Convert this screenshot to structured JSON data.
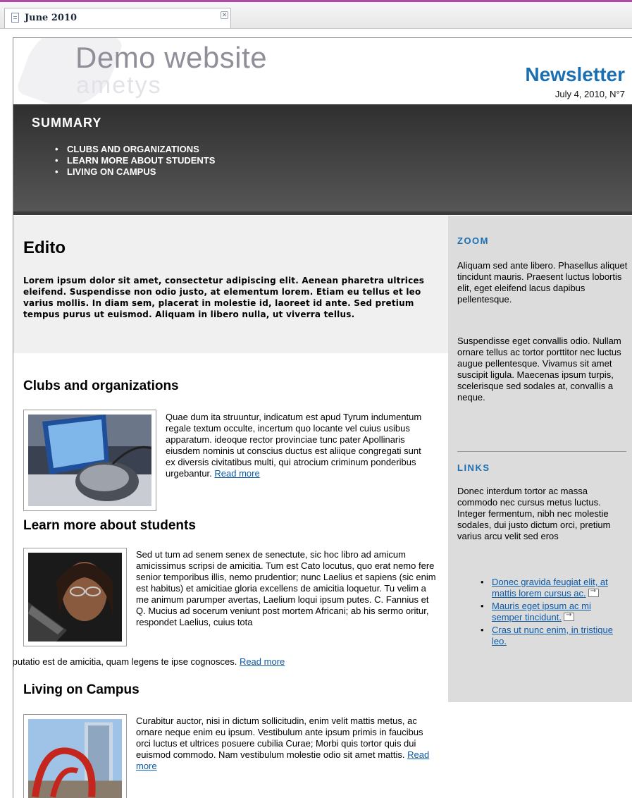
{
  "tab": {
    "title": "June 2010"
  },
  "header": {
    "logo_main": "Demo website",
    "logo_sub": "ametys",
    "title": "Newsletter",
    "date": "July 4, 2010, N°7"
  },
  "summary": {
    "title": "SUMMARY",
    "items": [
      "CLUBS AND ORGANIZATIONS",
      "LEARN MORE ABOUT STUDENTS",
      "LIVING ON CAMPUS"
    ]
  },
  "edito": {
    "title": "Edito",
    "text": "Lorem ipsum dolor sit amet, consectetur adipiscing elit. Aenean pharetra ultrices eleifend. Suspendisse non odio justo, at elementum lorem. Etiam eu tellus et leo varius mollis. In diam sem, placerat in molestie id, laoreet id ante. Sed pretium tempus purus ut euismod. Aliquam in libero nulla, ut viverra tellus."
  },
  "articles": [
    {
      "title": "Clubs and organizations",
      "text": "Quae dum ita struuntur, indicatum est apud Tyrum indumentum regale textum occulte, incertum quo locante vel cuius usibus apparatum. ideoque rector provinciae tunc pater Apollinaris eiusdem nominis ut conscius ductus est aliique congregati sunt ex diversis civitatibus multi, qui atrocium criminum ponderibus urgebantur.",
      "read_more": "Read more"
    },
    {
      "title": "Learn more about students",
      "text": "Sed ut tum ad senem senex de senectute, sic hoc libro ad amicum amicissimus scripsi de amicitia. Tum est Cato locutus, quo erat nemo fere senior temporibus illis, nemo prudentior; nunc Laelius et sapiens (sic enim est habitus) et amicitiae gloria excellens de amicitia loquetur. Tu velim a me animum parumper avertas, Laelium loqui ipsum putes. C. Fannius et Q. Mucius ad socerum veniunt post mortem Africani; ab his sermo oritur, respondet Laelius, cuius tota",
      "text_tail": "disputatio est de amicitia, quam legens te ipse cognosces.",
      "read_more": "Read more"
    },
    {
      "title": "Living on Campus",
      "text": "Curabitur auctor, nisi in dictum sollicitudin, enim velit mattis metus, ac ornare neque enim eu ipsum. Vestibulum ante ipsum primis in faucibus orci luctus et ultrices posuere cubilia Curae; Morbi quis tortor quis dui euismod commodo. Nam vestibulum molestie odio sit amet mattis.",
      "read_more": "Read more"
    }
  ],
  "sidebar": {
    "zoom_title": "ZOOM",
    "zoom_p1": "Aliquam sed ante libero. Phasellus aliquet tincidunt mauris. Praesent luctus lobortis elit, eget eleifend lacus dapibus pellentesque.",
    "zoom_p2": "Suspendisse eget convallis odio. Nullam ornare tellus ac tortor porttitor nec luctus augue pellentesque. Vivamus sit amet suscipit ligula. Maecenas ipsum turpis, scelerisque sed sodales at, convallis a neque.",
    "links_title": "LINKS",
    "links_text": "Donec interdum tortor ac massa commodo nec cursus metus luctus. Integer fermentum, nibh nec molestie sodales, dui justo dictum orci, pretium varius arcu velit sed eros",
    "links": [
      "Donec gravida feugiat elit, at mattis lorem cursus ac.",
      "Mauris eget ipsum ac mi semper tincidunt.",
      "Cras ut nunc enim, in tristique leo."
    ]
  },
  "colors": {
    "accent": "#1a6fb3",
    "link": "#0c5aa6",
    "sidebar_bg": "#dcdcdc",
    "summary_bg": "#3c3c3c"
  }
}
